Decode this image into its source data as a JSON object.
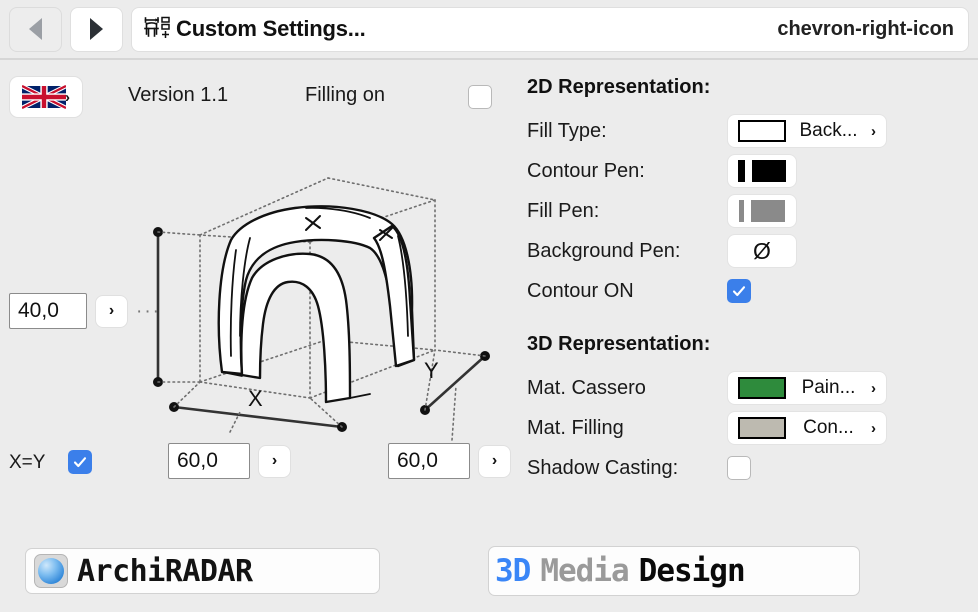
{
  "window": {
    "title": "Custom Settings...",
    "object_icon": "furniture-dimension-icon",
    "back_icon": "triangle-left-icon",
    "forward_icon": "triangle-right-icon",
    "disclosure_icon": "chevron-right-icon"
  },
  "info_row": {
    "language_flag": "uk-flag-icon",
    "language_chevron": "›",
    "version": "Version 1.1",
    "filling_label": "Filling on",
    "filling_checked": false
  },
  "preview": {
    "axis_x_label": "X",
    "axis_y_label": "Y",
    "object": "hand-drawn-tent-canopy-sketch"
  },
  "dimensions": {
    "z": {
      "value": "40,0",
      "stepper_icon": "›"
    },
    "x": {
      "value": "60,0",
      "stepper_icon": "›"
    },
    "y": {
      "value": "60,0",
      "stepper_icon": "›"
    },
    "xy_lock_label": "X=Y",
    "xy_lock_checked": true
  },
  "panel": {
    "section_2d": {
      "title": "2D Representation:",
      "rows": [
        {
          "label": "Fill Type:",
          "control": "popup",
          "value": "Back...",
          "swatch": "#ffffff",
          "chevron": "›"
        },
        {
          "label": "Contour Pen:",
          "control": "pen",
          "value": "",
          "swatch": "#000000"
        },
        {
          "label": "Fill Pen:",
          "control": "pen",
          "value": "",
          "swatch": "#8a8a8a"
        },
        {
          "label": "Background Pen:",
          "control": "null-pen",
          "value": "Ø",
          "swatch": "none"
        },
        {
          "label": "Contour ON",
          "control": "checkbox",
          "value": "",
          "checked": true
        }
      ]
    },
    "section_3d": {
      "title": "3D Representation:",
      "rows": [
        {
          "label": "Mat. Cassero",
          "control": "popup",
          "value": "Pain...",
          "swatch": "#2e8b3c",
          "chevron": "›"
        },
        {
          "label": "Mat. Filling",
          "control": "popup",
          "value": "Con...",
          "swatch": "#bdbab0",
          "chevron": "›"
        },
        {
          "label": "Shadow Casting:",
          "control": "checkbox",
          "value": "",
          "checked": false
        }
      ]
    }
  },
  "footer": {
    "logo_archiradar": {
      "text": "ArchiRADAR",
      "icon": "globe-icon"
    },
    "logo_3dmedia": {
      "part1": "3D",
      "part2": "Media",
      "part3": "Design"
    }
  },
  "colors": {
    "accent_blue": "#3b7fea",
    "window_bg": "#ececec",
    "green_swatch": "#2e8b3c",
    "tan_swatch": "#bdbab0"
  }
}
